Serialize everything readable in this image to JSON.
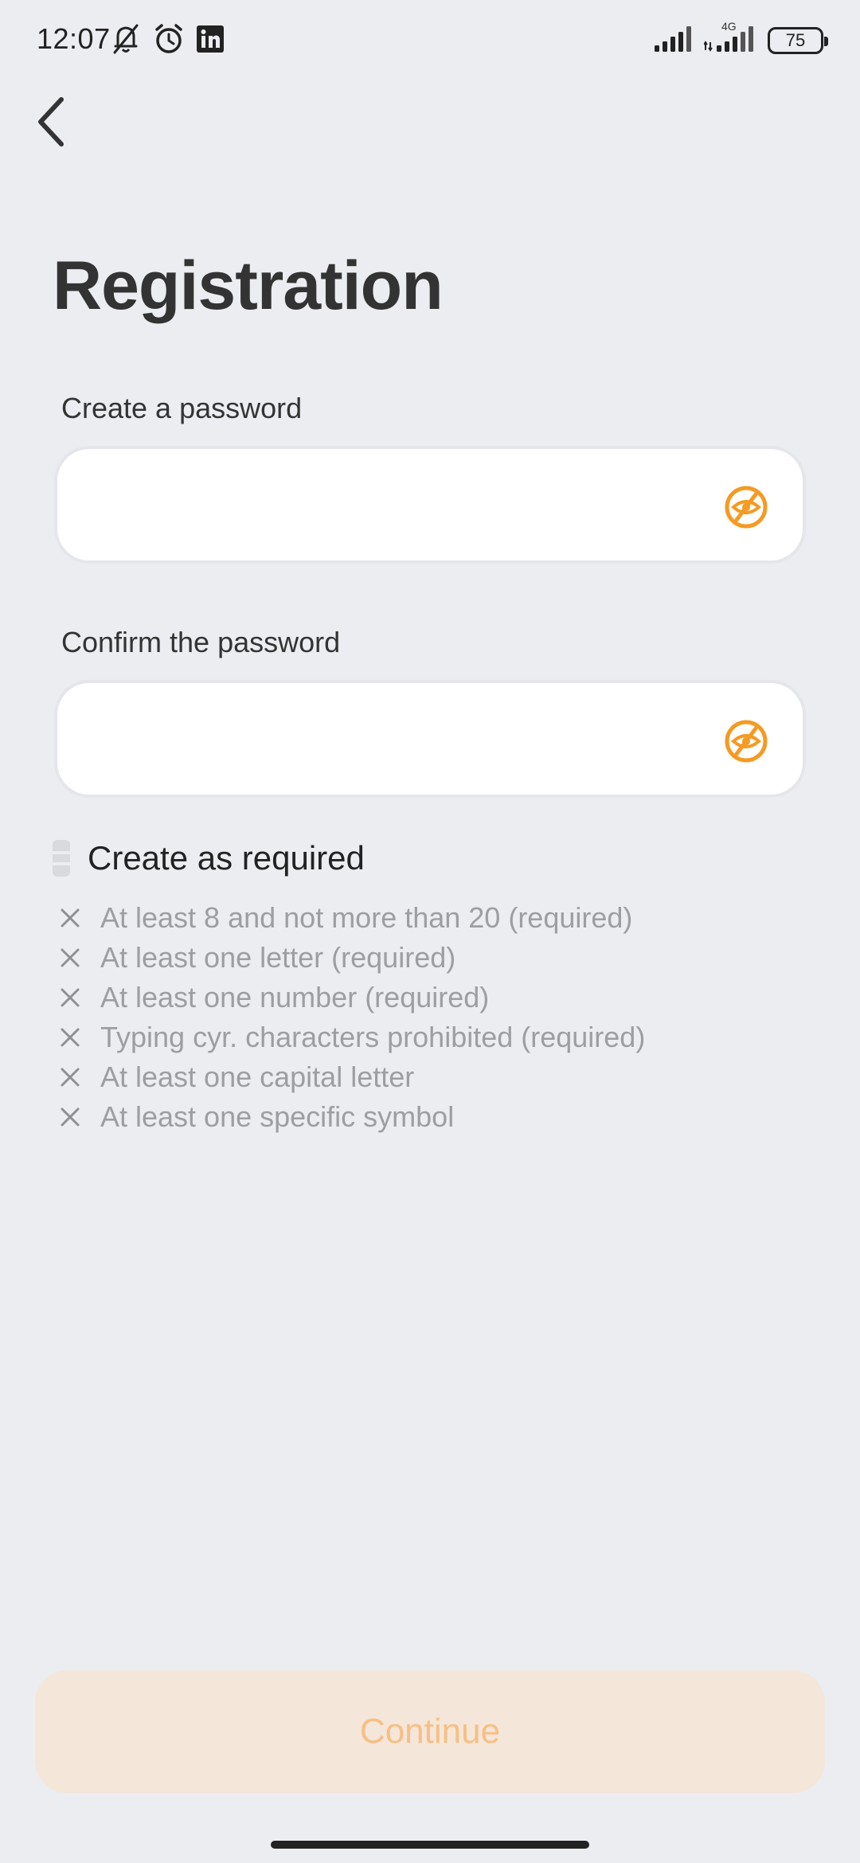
{
  "status_bar": {
    "time": "12:07",
    "network": "4G",
    "battery": "75",
    "icons_left": [
      "mute-bell-icon",
      "alarm-icon",
      "linkedin-icon"
    ],
    "icons_right": [
      "signal-icon",
      "signal-4g-icon",
      "battery-icon"
    ]
  },
  "header": {
    "back_icon": "chevron-left-icon"
  },
  "page": {
    "title": "Registration"
  },
  "form": {
    "password": {
      "label": "Create a password",
      "value": "",
      "toggle_icon": "eye-hidden-icon"
    },
    "confirm": {
      "label": "Confirm the password",
      "value": "",
      "toggle_icon": "eye-hidden-icon"
    }
  },
  "requirements": {
    "title": "Create as required",
    "items": [
      {
        "text": "At least 8 and not more than 20 (required)",
        "met": false
      },
      {
        "text": "At least one letter (required)",
        "met": false
      },
      {
        "text": "At least one number (required)",
        "met": false
      },
      {
        "text": "Typing cyr. characters prohibited (required)",
        "met": false
      },
      {
        "text": "At least one capital letter",
        "met": false
      },
      {
        "text": "At least one specific symbol",
        "met": false
      }
    ]
  },
  "actions": {
    "continue_label": "Continue"
  },
  "colors": {
    "accent": "#F59A23",
    "accent_disabled_bg": "#F4E6D9",
    "accent_disabled_text": "#F7BF84",
    "background": "#ECEDF0",
    "muted_text": "#9C9EA3"
  }
}
